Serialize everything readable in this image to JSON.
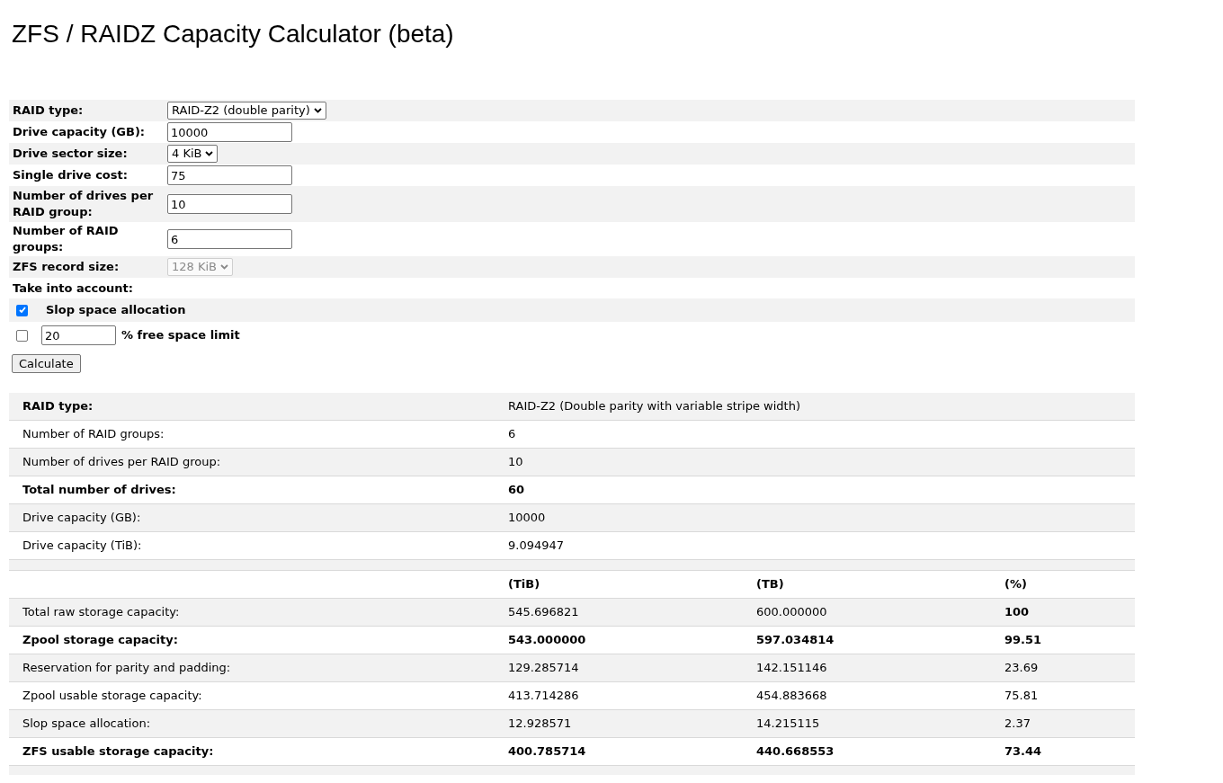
{
  "title": "ZFS / RAIDZ Capacity Calculator (beta)",
  "form": {
    "rows": [
      {
        "label": "RAID type:",
        "kind": "select",
        "value": "RAID-Z2 (double parity)",
        "disabled": false
      },
      {
        "label": "Drive capacity (GB):",
        "kind": "input",
        "value": "10000"
      },
      {
        "label": "Drive sector size:",
        "kind": "select",
        "value": "4 KiB",
        "disabled": false
      },
      {
        "label": "Single drive cost:",
        "kind": "input",
        "value": "75"
      },
      {
        "label": "Number of drives per RAID group:",
        "kind": "input",
        "value": "10"
      },
      {
        "label": "Number of RAID groups:",
        "kind": "input",
        "value": "6"
      },
      {
        "label": "ZFS record size:",
        "kind": "select",
        "value": "128 KiB",
        "disabled": true
      }
    ],
    "account_label": "Take into account:",
    "options": [
      {
        "kind": "checkbox",
        "checked": true,
        "label": "Slop space allocation"
      },
      {
        "kind": "checkbox_input",
        "checked": false,
        "value": "20",
        "suffix": "% free space limit"
      }
    ],
    "button": "Calculate"
  },
  "summary": [
    {
      "label": "RAID type:",
      "value": "RAID-Z2 (Double parity with variable stripe width)",
      "bold": true,
      "value_bold": false
    },
    {
      "label": "Number of RAID groups:",
      "value": "6",
      "bold": false,
      "value_bold": false
    },
    {
      "label": "Number of drives per RAID group:",
      "value": "10",
      "bold": false,
      "value_bold": false
    },
    {
      "label": "Total number of drives:",
      "value": "60",
      "bold": true,
      "value_bold": true
    },
    {
      "label": "Drive capacity (GB):",
      "value": "10000",
      "bold": false,
      "value_bold": false
    },
    {
      "label": "Drive capacity (TiB):",
      "value": "9.094947",
      "bold": false,
      "value_bold": false
    }
  ],
  "capacity": {
    "columns": [
      "(TiB)",
      "(TB)",
      "(%)"
    ],
    "rows": [
      {
        "label": "Total raw storage capacity:",
        "values": [
          "545.696821",
          "600.000000",
          "100"
        ],
        "bold": false,
        "percent_bold": true
      },
      {
        "label": "Zpool storage capacity:",
        "values": [
          "543.000000",
          "597.034814",
          "99.51"
        ],
        "bold": true
      },
      {
        "label": "Reservation for parity and padding:",
        "values": [
          "129.285714",
          "142.151146",
          "23.69"
        ],
        "bold": false
      },
      {
        "label": "Zpool usable storage capacity:",
        "values": [
          "413.714286",
          "454.883668",
          "75.81"
        ],
        "bold": false
      },
      {
        "label": "Slop space allocation:",
        "values": [
          "12.928571",
          "14.215115",
          "2.37"
        ],
        "bold": false
      },
      {
        "label": "ZFS usable storage capacity:",
        "values": [
          "400.785714",
          "440.668553",
          "73.44"
        ],
        "bold": true
      }
    ]
  }
}
